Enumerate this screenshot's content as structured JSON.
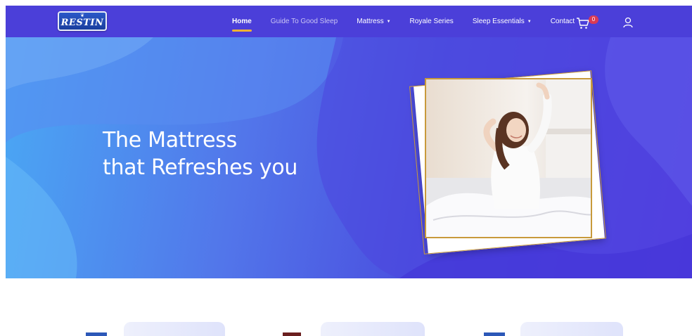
{
  "brand": {
    "logo_text": "RESTIN",
    "logo_color": "#1f4bb0"
  },
  "nav": {
    "background": "#4b3fd9",
    "items": [
      {
        "label": "Home",
        "active": true,
        "dropdown": false
      },
      {
        "label": "Guide To Good Sleep",
        "active": false,
        "dropdown": false
      },
      {
        "label": "Mattress",
        "active": false,
        "dropdown": true
      },
      {
        "label": "Royale Series",
        "active": false,
        "dropdown": false
      },
      {
        "label": "Sleep Essentials",
        "active": false,
        "dropdown": true
      },
      {
        "label": "Contact",
        "active": false,
        "dropdown": false
      }
    ],
    "cart": {
      "icon": "cart-icon",
      "count": "0"
    },
    "account": {
      "icon": "user-icon"
    },
    "active_underline_color": "#f2b233"
  },
  "hero": {
    "headline_line1": "The Mattress",
    "headline_line2": "that Refreshes you",
    "frame_color": "#c89a3b"
  }
}
